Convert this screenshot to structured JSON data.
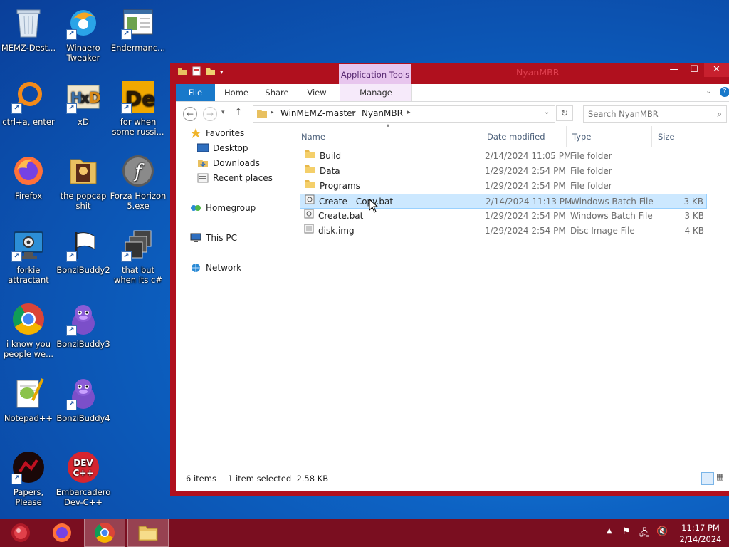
{
  "desktop": {
    "icons": [
      {
        "label": "MEMZ-Dest...",
        "icon": "recycle-bin-icon"
      },
      {
        "label": "Winaero Tweaker",
        "icon": "winaero-icon"
      },
      {
        "label": "Endermanc...",
        "icon": "window-app-icon"
      },
      {
        "label": "ctrl+a, enter",
        "icon": "orange-ring-icon"
      },
      {
        "label": "xD",
        "icon": "hxd-icon"
      },
      {
        "label": "for when some russi...",
        "icon": "de-icon"
      },
      {
        "label": "Firefox",
        "icon": "firefox-icon"
      },
      {
        "label": "the popcap shit",
        "icon": "popcap-folder-icon"
      },
      {
        "label": "Forza Horizon 5.exe",
        "icon": "flash-icon"
      },
      {
        "label": "forkie attractant",
        "icon": "monitor-gear-icon"
      },
      {
        "label": "BonziBuddy2",
        "icon": "flag-icon"
      },
      {
        "label": "that but when its c#",
        "icon": "stacked-windows-icon"
      },
      {
        "label": "i know you people we...",
        "icon": "chrome-icon"
      },
      {
        "label": "BonziBuddy3",
        "icon": "bonzi-icon"
      },
      {
        "label": "Notepad++",
        "icon": "notepad-plus-icon"
      },
      {
        "label": "BonziBuddy4",
        "icon": "bonzi-icon"
      },
      {
        "label": "Papers, Please",
        "icon": "papers-please-icon"
      },
      {
        "label": "Embarcadero Dev-C++",
        "icon": "devcpp-icon"
      }
    ]
  },
  "window": {
    "title": "NyanMBR",
    "app_tools_label": "Application Tools",
    "ribbon_tabs": [
      "File",
      "Home",
      "Share",
      "View",
      "Manage"
    ],
    "breadcrumb": [
      "WinMEMZ-master",
      "NyanMBR"
    ],
    "search_placeholder": "Search NyanMBR",
    "nav": {
      "favorites": "Favorites",
      "desktop": "Desktop",
      "downloads": "Downloads",
      "recent": "Recent places",
      "homegroup": "Homegroup",
      "thispc": "This PC",
      "network": "Network"
    },
    "columns": {
      "name": "Name",
      "date": "Date modified",
      "type": "Type",
      "size": "Size"
    },
    "files": [
      {
        "name": "Build",
        "date": "2/14/2024 11:05 PM",
        "type": "File folder",
        "size": "",
        "kind": "folder"
      },
      {
        "name": "Data",
        "date": "1/29/2024 2:54 PM",
        "type": "File folder",
        "size": "",
        "kind": "folder"
      },
      {
        "name": "Programs",
        "date": "1/29/2024 2:54 PM",
        "type": "File folder",
        "size": "",
        "kind": "folder"
      },
      {
        "name": "Create - Copy.bat",
        "date": "2/14/2024 11:13 PM",
        "type": "Windows Batch File",
        "size": "3 KB",
        "kind": "bat",
        "selected": true
      },
      {
        "name": "Create.bat",
        "date": "1/29/2024 2:54 PM",
        "type": "Windows Batch File",
        "size": "3 KB",
        "kind": "bat"
      },
      {
        "name": "disk.img",
        "date": "1/29/2024 2:54 PM",
        "type": "Disc Image File",
        "size": "4 KB",
        "kind": "img"
      }
    ],
    "status": {
      "count": "6 items",
      "selection": "1 item selected  2.58 KB"
    }
  },
  "taskbar": {
    "time": "11:17 PM",
    "date": "2/14/2024"
  },
  "colors": {
    "window_frame": "#b0101e",
    "taskbar": "#7a0e20",
    "selection": "#cce8ff",
    "file_tab": "#1979ca"
  }
}
